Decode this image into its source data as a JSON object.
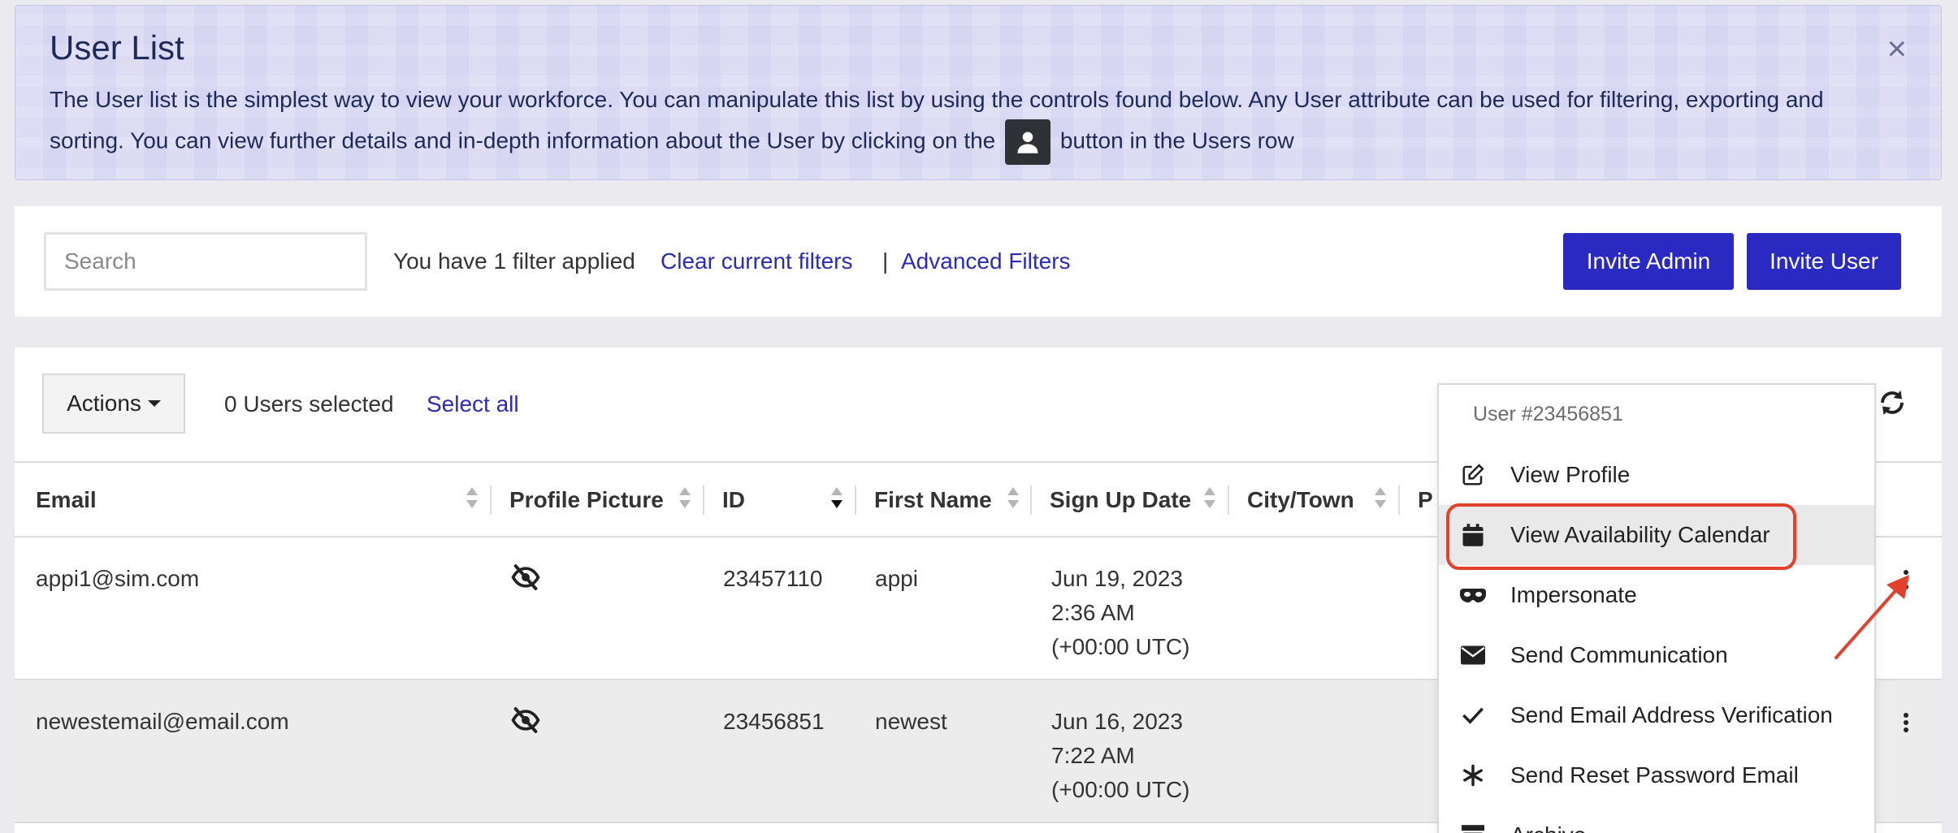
{
  "banner": {
    "title": "User List",
    "close": "×",
    "text_before": "The User list is the simplest way to view your workforce. You can manipulate this list by using the controls found below. Any User attribute can be used for filtering, exporting and sorting. You can view further details and in-depth information about the User by clicking on the",
    "text_after": "button in the Users row"
  },
  "filters": {
    "search_placeholder": "Search",
    "applied_text": "You have 1 filter applied",
    "clear_link": "Clear current filters",
    "separator": "|",
    "advanced_link": "Advanced Filters",
    "invite_admin": "Invite Admin",
    "invite_user": "Invite User"
  },
  "users": {
    "actions_label": "Actions",
    "selected_text": "0 Users selected",
    "select_all": "Select all",
    "columns": [
      "Email",
      "Profile Picture",
      "ID",
      "First Name",
      "Sign Up Date",
      "City/Town",
      "P"
    ],
    "rows": [
      {
        "email": "appi1@sim.com",
        "id": "23457110",
        "first_name": "appi",
        "signup_date": "Jun 19, 2023",
        "signup_time": "2:36 AM",
        "signup_tz": "(+00:00 UTC)"
      },
      {
        "email": "newestemail@email.com",
        "id": "23456851",
        "first_name": "newest",
        "signup_date": "Jun 16, 2023",
        "signup_time": "7:22 AM",
        "signup_tz": "(+00:00 UTC)"
      }
    ]
  },
  "dropdown": {
    "header": "User #23456851",
    "items": [
      {
        "label": "View Profile",
        "icon": "edit-icon"
      },
      {
        "label": "View Availability Calendar",
        "icon": "calendar-icon"
      },
      {
        "label": "Impersonate",
        "icon": "mask-icon"
      },
      {
        "label": "Send Communication",
        "icon": "envelope-icon"
      },
      {
        "label": "Send Email Address Verification",
        "icon": "check-icon"
      },
      {
        "label": "Send Reset Password Email",
        "icon": "asterisk-icon"
      },
      {
        "label": "Archive",
        "icon": "archive-icon"
      }
    ]
  },
  "colors": {
    "primary": "#2a2ac2",
    "link": "#2b2bb8",
    "banner_bg": "#d6d5f2",
    "highlight": "#e2412c"
  }
}
